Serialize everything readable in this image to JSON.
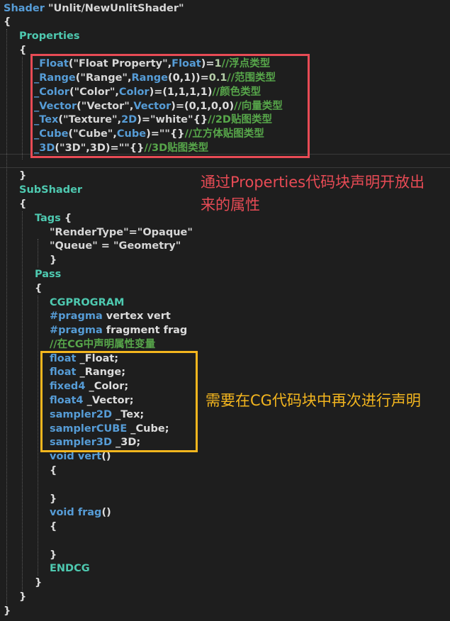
{
  "editor": {
    "lines": [
      [
        {
          "t": "Shader ",
          "c": "kw"
        },
        {
          "t": "\"Unlit/NewUnlitShader\"",
          "c": "str"
        }
      ],
      [
        {
          "t": "{",
          "c": "plain"
        }
      ],
      [
        {
          "t": "Properties",
          "c": "prop"
        }
      ],
      [
        {
          "t": "{",
          "c": "plain"
        }
      ],
      [
        {
          "t": "_Float",
          "c": "kw"
        },
        {
          "t": "(",
          "c": "plain"
        },
        {
          "t": "\"Float Property\"",
          "c": "str"
        },
        {
          "t": ",",
          "c": "plain"
        },
        {
          "t": "Float",
          "c": "kw"
        },
        {
          "t": ")=",
          "c": "plain"
        },
        {
          "t": "1",
          "c": "num"
        },
        {
          "t": "//浮点类型",
          "c": "cmt"
        }
      ],
      [
        {
          "t": "_Range",
          "c": "kw"
        },
        {
          "t": "(",
          "c": "plain"
        },
        {
          "t": "\"Range\"",
          "c": "str"
        },
        {
          "t": ",",
          "c": "plain"
        },
        {
          "t": "Range",
          "c": "kw"
        },
        {
          "t": "(0,1))=",
          "c": "plain"
        },
        {
          "t": "0.1",
          "c": "num"
        },
        {
          "t": "//范围类型",
          "c": "cmt"
        }
      ],
      [
        {
          "t": "_Color",
          "c": "kw"
        },
        {
          "t": "(",
          "c": "plain"
        },
        {
          "t": "\"Color\"",
          "c": "str"
        },
        {
          "t": ",",
          "c": "plain"
        },
        {
          "t": "Color",
          "c": "kw"
        },
        {
          "t": ")=(1,1,1,1)",
          "c": "plain"
        },
        {
          "t": "//颜色类型",
          "c": "cmt"
        }
      ],
      [
        {
          "t": "_Vector",
          "c": "kw"
        },
        {
          "t": "(",
          "c": "plain"
        },
        {
          "t": "\"Vector\"",
          "c": "str"
        },
        {
          "t": ",",
          "c": "plain"
        },
        {
          "t": "Vector",
          "c": "kw"
        },
        {
          "t": ")=(0,1,0,0)",
          "c": "plain"
        },
        {
          "t": "//向量类型",
          "c": "cmt"
        }
      ],
      [
        {
          "t": "_Tex",
          "c": "kw"
        },
        {
          "t": "(",
          "c": "plain"
        },
        {
          "t": "\"Texture\"",
          "c": "str"
        },
        {
          "t": ",",
          "c": "plain"
        },
        {
          "t": "2D",
          "c": "kw"
        },
        {
          "t": ")=",
          "c": "plain"
        },
        {
          "t": "\"white\"",
          "c": "str"
        },
        {
          "t": "{}",
          "c": "plain"
        },
        {
          "t": "//2D贴图类型",
          "c": "cmt"
        }
      ],
      [
        {
          "t": "_Cube",
          "c": "kw"
        },
        {
          "t": "(",
          "c": "plain"
        },
        {
          "t": "\"Cube\"",
          "c": "str"
        },
        {
          "t": ",",
          "c": "plain"
        },
        {
          "t": "Cube",
          "c": "kw"
        },
        {
          "t": ")=",
          "c": "plain"
        },
        {
          "t": "\"\"",
          "c": "str"
        },
        {
          "t": "{}",
          "c": "plain"
        },
        {
          "t": "//立方体贴图类型",
          "c": "cmt"
        }
      ],
      [
        {
          "t": "_3D",
          "c": "kw"
        },
        {
          "t": "(",
          "c": "plain"
        },
        {
          "t": "\"3D\"",
          "c": "str"
        },
        {
          "t": ",3D)=",
          "c": "plain"
        },
        {
          "t": "\"\"",
          "c": "str"
        },
        {
          "t": "{}",
          "c": "plain"
        },
        {
          "t": "//3D贴图类型",
          "c": "cmt"
        }
      ],
      [],
      [
        {
          "t": "}",
          "c": "plain"
        }
      ],
      [
        {
          "t": "SubShader",
          "c": "prop"
        }
      ],
      [
        {
          "t": "{",
          "c": "plain"
        }
      ],
      [
        {
          "t": "Tags",
          "c": "prop"
        },
        {
          "t": " {",
          "c": "plain"
        }
      ],
      [
        {
          "t": "\"RenderType\"",
          "c": "str"
        },
        {
          "t": "=",
          "c": "plain"
        },
        {
          "t": "\"Opaque\"",
          "c": "str"
        }
      ],
      [
        {
          "t": "\"Queue\"",
          "c": "str"
        },
        {
          "t": " = ",
          "c": "plain"
        },
        {
          "t": "\"Geometry\"",
          "c": "str"
        }
      ],
      [
        {
          "t": "}",
          "c": "plain"
        }
      ],
      [
        {
          "t": "Pass",
          "c": "prop"
        }
      ],
      [
        {
          "t": "{",
          "c": "plain"
        }
      ],
      [
        {
          "t": "CGPROGRAM",
          "c": "prop"
        }
      ],
      [
        {
          "t": "#pragma",
          "c": "kw"
        },
        {
          "t": " vertex vert",
          "c": "plain"
        }
      ],
      [
        {
          "t": "#pragma",
          "c": "kw"
        },
        {
          "t": " fragment frag",
          "c": "plain"
        }
      ],
      [
        {
          "t": "//在CG中声明属性变量",
          "c": "cmt"
        }
      ],
      [
        {
          "t": "float",
          "c": "kw"
        },
        {
          "t": " _Float;",
          "c": "plain"
        }
      ],
      [
        {
          "t": "float",
          "c": "kw"
        },
        {
          "t": " _Range;",
          "c": "plain"
        }
      ],
      [
        {
          "t": "fixed4",
          "c": "kw"
        },
        {
          "t": " _Color;",
          "c": "plain"
        }
      ],
      [
        {
          "t": "float4",
          "c": "kw"
        },
        {
          "t": " _Vector;",
          "c": "plain"
        }
      ],
      [
        {
          "t": "sampler2D",
          "c": "kw"
        },
        {
          "t": " _Tex;",
          "c": "plain"
        }
      ],
      [
        {
          "t": "samplerCUBE",
          "c": "kw"
        },
        {
          "t": " _Cube;",
          "c": "plain"
        }
      ],
      [
        {
          "t": "sampler3D",
          "c": "kw"
        },
        {
          "t": " _3D;",
          "c": "plain"
        }
      ],
      [
        {
          "t": "void",
          "c": "kw"
        },
        {
          "t": " vert",
          "c": "kw"
        },
        {
          "t": "()",
          "c": "plain"
        }
      ],
      [
        {
          "t": "{",
          "c": "plain"
        }
      ],
      [],
      [
        {
          "t": "}",
          "c": "plain"
        }
      ],
      [
        {
          "t": "void",
          "c": "kw"
        },
        {
          "t": " frag",
          "c": "kw"
        },
        {
          "t": "()",
          "c": "plain"
        }
      ],
      [
        {
          "t": "{",
          "c": "plain"
        }
      ],
      [],
      [
        {
          "t": "}",
          "c": "plain"
        }
      ],
      [
        {
          "t": "ENDCG",
          "c": "prop"
        }
      ],
      [
        {
          "t": "}",
          "c": "plain"
        }
      ],
      [
        {
          "t": "}",
          "c": "plain"
        }
      ],
      [
        {
          "t": "}",
          "c": "plain"
        }
      ]
    ]
  },
  "annotations": {
    "properties_note": "通过Properties代码块声明开放出来的属性",
    "cg_note": "需要在CG代码块中再次进行声明"
  },
  "colors": {
    "background": "#1e1e1e",
    "keyword": "#569cd6",
    "type": "#4ec9b0",
    "comment": "#57a64a",
    "red_highlight": "#e84b55",
    "yellow_highlight": "#f4b61e"
  }
}
